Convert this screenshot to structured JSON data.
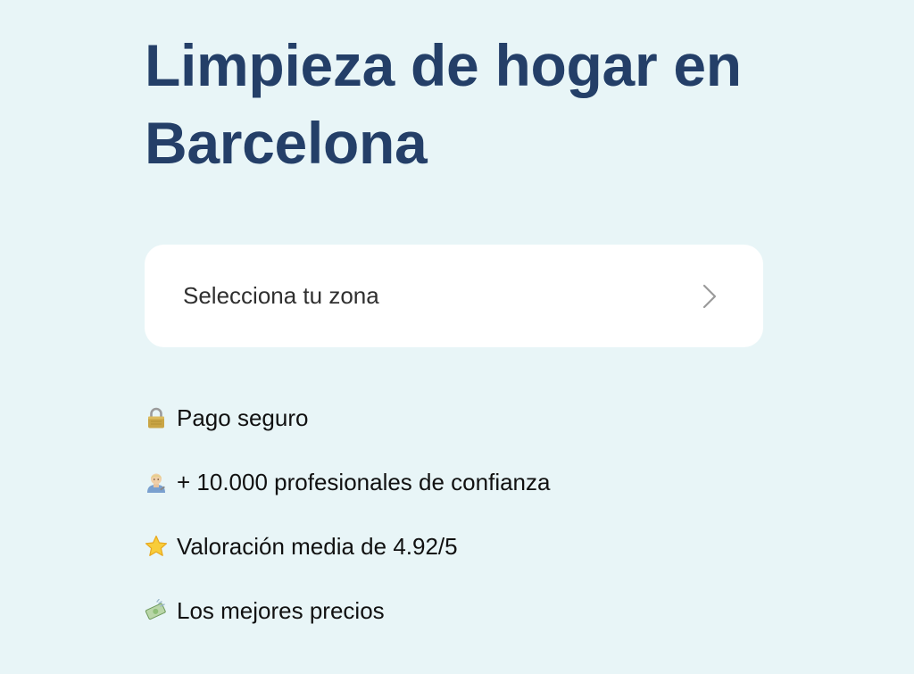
{
  "page": {
    "title": "Limpieza de hogar en Barcelona"
  },
  "zone_selector": {
    "label": "Selecciona tu zona",
    "icon": "chevron-right-icon"
  },
  "features": [
    {
      "icon": "lock-icon",
      "text": "Pago seguro"
    },
    {
      "icon": "professional-icon",
      "text": "+ 10.000 profesionales de confianza"
    },
    {
      "icon": "star-icon",
      "text": "Valoración media de 4.92/5"
    },
    {
      "icon": "money-icon",
      "text": "Los mejores precios"
    }
  ],
  "colors": {
    "background": "#e8f5f7",
    "title": "#243f68",
    "card": "#ffffff",
    "text": "#111111"
  }
}
